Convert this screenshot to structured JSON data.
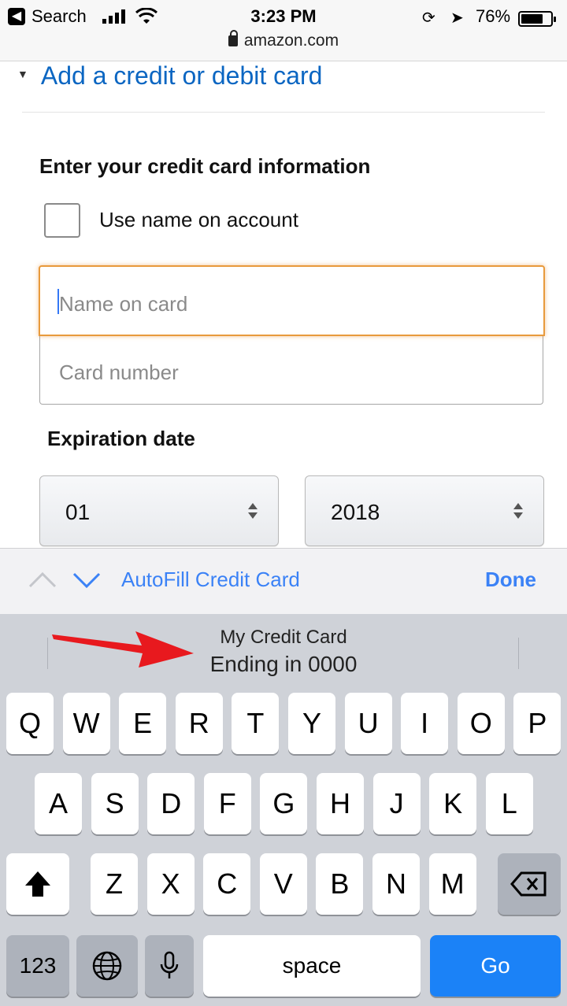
{
  "status_bar": {
    "back_app": "Search",
    "time": "3:23 PM",
    "battery_percent": "76%",
    "battery_level": 0.76,
    "url": "amazon.com"
  },
  "page": {
    "add_card_link": "Add a credit or debit card",
    "section_title": "Enter your credit card information",
    "checkbox_label": "Use name on account",
    "name_placeholder": "Name on card",
    "card_number_placeholder": "Card number",
    "expiration_title": "Expiration date",
    "month_value": "01",
    "year_value": "2018"
  },
  "accessory": {
    "autofill_label": "AutoFill Credit Card",
    "done_label": "Done"
  },
  "suggestion": {
    "line1": "My Credit Card",
    "line2": "Ending in 0000"
  },
  "keyboard": {
    "row1": [
      "Q",
      "W",
      "E",
      "R",
      "T",
      "Y",
      "U",
      "I",
      "O",
      "P"
    ],
    "row2": [
      "A",
      "S",
      "D",
      "F",
      "G",
      "H",
      "J",
      "K",
      "L"
    ],
    "row3": [
      "Z",
      "X",
      "C",
      "V",
      "B",
      "N",
      "M"
    ],
    "numbers_key": "123",
    "space_key": "space",
    "go_key": "Go"
  },
  "colors": {
    "link": "#0b66c2",
    "focus_border": "#e89a3c",
    "ios_blue": "#3b82f6",
    "annotation_arrow": "#e8191e"
  },
  "icons": {
    "back": "back-arrow-icon",
    "signal": "cellular-signal-icon",
    "wifi": "wifi-icon",
    "rotation_lock": "rotation-lock-icon",
    "location": "location-arrow-icon",
    "battery": "battery-icon",
    "lock": "lock-icon",
    "shift": "shift-icon",
    "delete": "delete-icon",
    "globe": "globe-icon",
    "microphone": "microphone-icon"
  }
}
